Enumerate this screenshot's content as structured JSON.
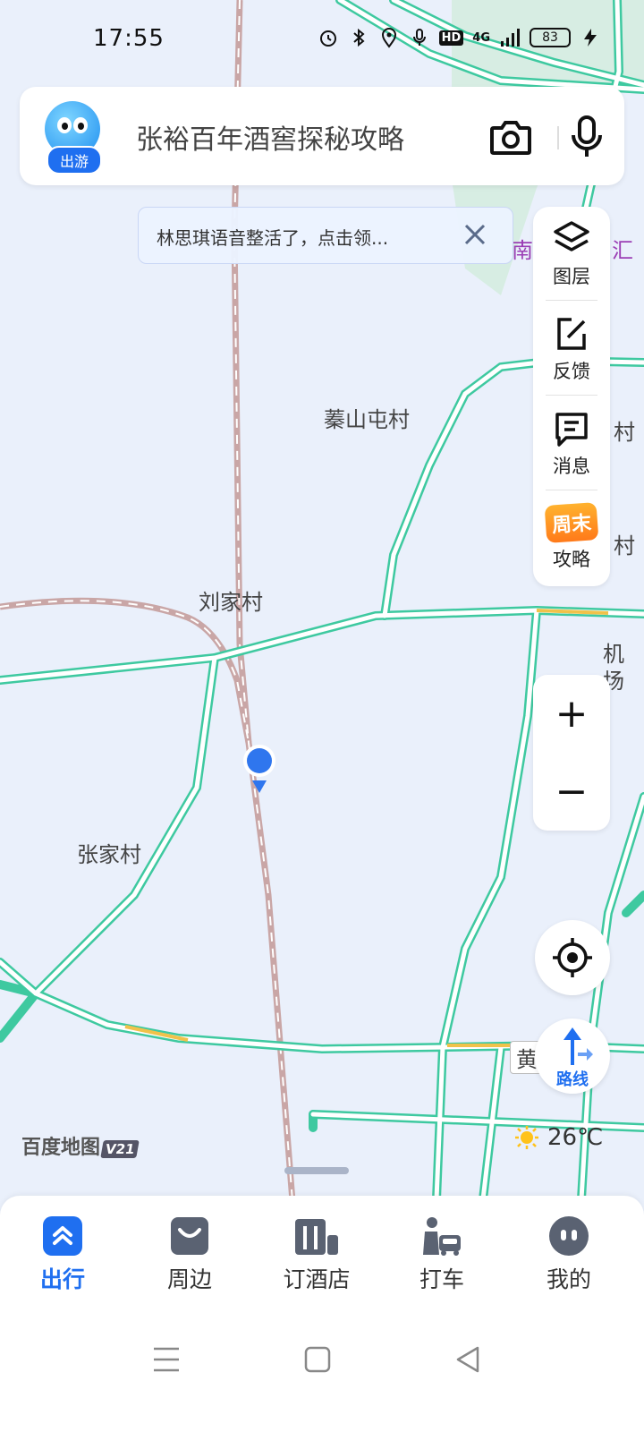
{
  "status_bar": {
    "time": "17:55",
    "battery": "83",
    "network": "4G",
    "hd": "HD",
    "icons": [
      "alarm-icon",
      "bluetooth-icon",
      "location-icon",
      "mic-icon",
      "hd-icon",
      "signal-icon",
      "battery-icon",
      "charging-icon"
    ]
  },
  "search": {
    "badge": "出游",
    "query": "张裕百年酒窖探秘攻略",
    "camera_icon": "camera-icon",
    "mic_icon": "microphone-icon"
  },
  "tip": {
    "text": "林思琪语音整活了，点击领..."
  },
  "right_panel": {
    "items": [
      {
        "label": "图层",
        "icon": "layers-icon"
      },
      {
        "label": "反馈",
        "icon": "feedback-icon"
      },
      {
        "label": "消息",
        "icon": "message-icon"
      },
      {
        "label": "攻略",
        "icon": "weekend-icon",
        "badge": "周末"
      }
    ]
  },
  "zoom": {
    "in": "+",
    "out": "−"
  },
  "route": {
    "label": "路线"
  },
  "map": {
    "labels": [
      "蓁山屯村",
      "刘家村",
      "张家村",
      "机场",
      "黄",
      "南",
      "汇",
      "村",
      "村"
    ]
  },
  "brand": {
    "name": "百度地图",
    "version": "V21"
  },
  "weather": {
    "temp": "26℃",
    "icon": "sun-icon"
  },
  "bottom_nav": {
    "items": [
      {
        "label": "出行",
        "icon": "travel-icon",
        "active": true
      },
      {
        "label": "周边",
        "icon": "nearby-icon",
        "active": false
      },
      {
        "label": "订酒店",
        "icon": "hotel-icon",
        "active": false
      },
      {
        "label": "打车",
        "icon": "taxi-icon",
        "active": false
      },
      {
        "label": "我的",
        "icon": "profile-icon",
        "active": false
      }
    ]
  },
  "colors": {
    "accent": "#1f6ff0",
    "road": "#3ec9a0",
    "map_bg": "#eaf0fb",
    "rail": "#c9a6a6"
  }
}
